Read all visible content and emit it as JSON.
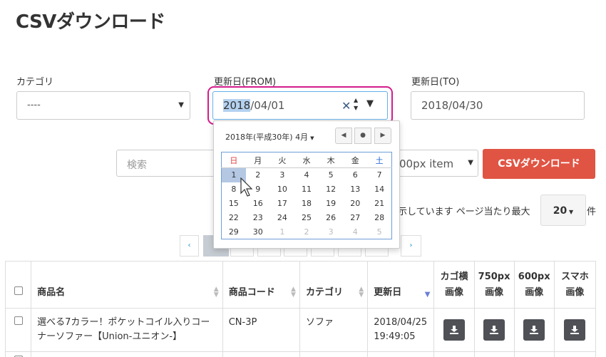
{
  "page": {
    "title": "CSVダウンロード"
  },
  "filters": {
    "category_label": "カテゴリ",
    "category_value": "----",
    "date_from_label": "更新日(FROM)",
    "date_from_year": "2018",
    "date_from_rest": "/04/01",
    "date_to_label": "更新日(TO)",
    "date_to_value": "2018/04/30",
    "search_placeholder": "検索",
    "item_select_value": "00px item",
    "csv_button": "CSVダウンロード"
  },
  "datepicker": {
    "month_label": "2018年(平成30年) 4月",
    "weekdays": [
      "日",
      "月",
      "火",
      "水",
      "木",
      "金",
      "土"
    ],
    "weeks": [
      [
        "1",
        "2",
        "3",
        "4",
        "5",
        "6",
        "7"
      ],
      [
        "8",
        "9",
        "10",
        "11",
        "12",
        "13",
        "14"
      ],
      [
        "15",
        "16",
        "17",
        "18",
        "19",
        "20",
        "21"
      ],
      [
        "22",
        "23",
        "24",
        "25",
        "26",
        "27",
        "28"
      ],
      [
        "29",
        "30",
        "1",
        "2",
        "3",
        "4",
        "5"
      ]
    ],
    "selected": "1"
  },
  "results": {
    "summary": "示しています ページ当たり最大",
    "per_page": "20",
    "unit": "件"
  },
  "pagination": {
    "prev": "‹",
    "next": "›"
  },
  "table": {
    "headers": {
      "name": "商品名",
      "code": "商品コード",
      "category": "カテゴリ",
      "updated": "更新日",
      "cart_line1": "カゴ横",
      "cart_line2": "画像",
      "px750_line1": "750px",
      "px750_line2": "画像",
      "px600_line1": "600px",
      "px600_line2": "画像",
      "sp_line1": "スマホ",
      "sp_line2": "画像"
    },
    "rows": [
      {
        "name": "選べる7カラー！ポケットコイル入りコーナーソファー【Union-ユニオン-】",
        "code": "CN-3P",
        "category": "ソファ",
        "date": "2018/04/25",
        "time": "19:49:05"
      }
    ]
  },
  "colors": {
    "accent_red": "#e05443",
    "highlight_magenta": "#d41c8c",
    "link_blue": "#1a8fc6"
  }
}
